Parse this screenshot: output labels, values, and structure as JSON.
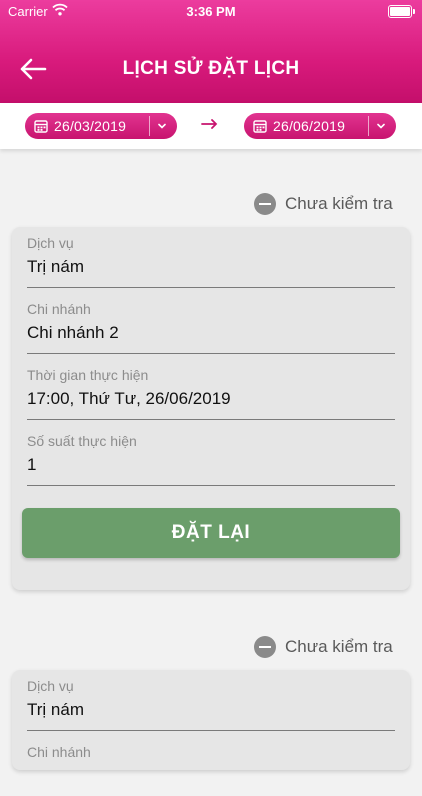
{
  "status_bar": {
    "carrier": "Carrier",
    "time": "3:36 PM"
  },
  "header": {
    "title": "LỊCH SỬ ĐẶT LỊCH",
    "back_icon": "arrow-left-icon",
    "gradient_colors": [
      "#ec3c9e",
      "#c40f6b"
    ]
  },
  "filter": {
    "from_date": "26/03/2019",
    "to_date": "26/06/2019"
  },
  "bookings": [
    {
      "status": "Chưa kiểm tra",
      "service_label": "Dịch vụ",
      "service_value": "Trị nám",
      "branch_label": "Chi nhánh",
      "branch_value": "Chi nhánh 2",
      "time_label": "Thời gian thực hiện",
      "time_value": "17:00, Thứ Tư, 26/06/2019",
      "slots_label": "Số suất thực hiện",
      "slots_value": "1",
      "rebook_label": "ĐẶT LẠI"
    },
    {
      "status": "Chưa kiểm tra",
      "service_label": "Dịch vụ",
      "service_value": "Trị nám",
      "branch_label": "Chi nhánh"
    }
  ],
  "colors": {
    "accent": "#d81a7c",
    "rebook_button": "#6b9e6b",
    "card": "#e6e6e6"
  }
}
